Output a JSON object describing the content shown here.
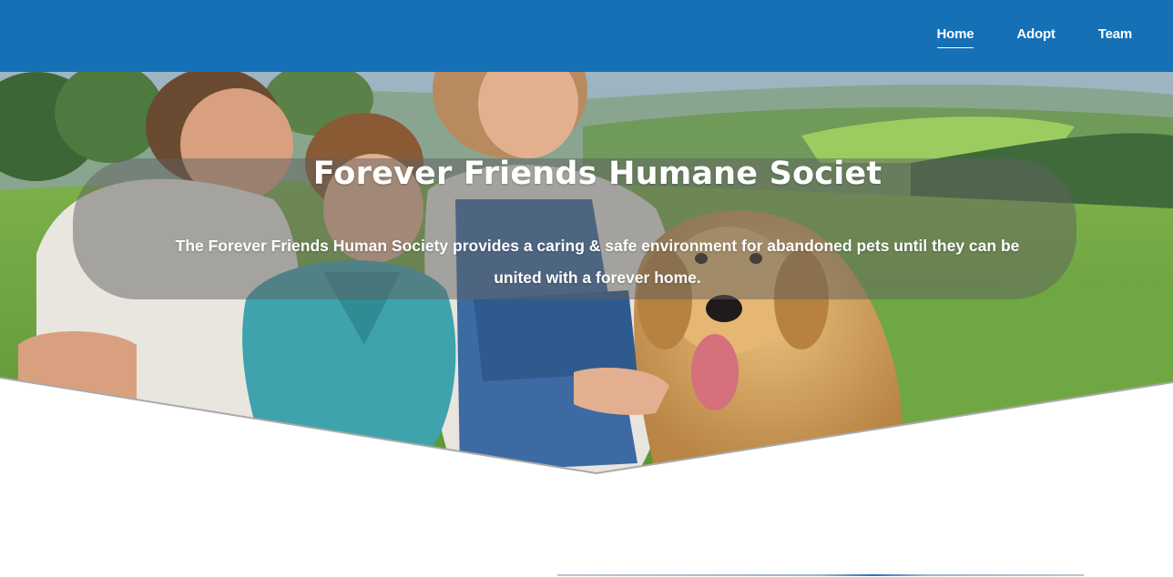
{
  "nav": {
    "items": [
      {
        "label": "Home",
        "active": true
      },
      {
        "label": "Adopt",
        "active": false
      },
      {
        "label": "Team",
        "active": false
      }
    ]
  },
  "hero": {
    "title": "Forever Friends Humane Societ",
    "description": "The Forever Friends Human Society provides a caring & safe environment for abandoned pets until they can be united with a forever home.",
    "image": "family-with-golden-retriever-photo"
  },
  "colors": {
    "navbar": "#1570b5",
    "nav_text": "#ffffff",
    "banner_overlay": "rgba(95,95,95,0.5)",
    "page_background": "#ffffff"
  }
}
